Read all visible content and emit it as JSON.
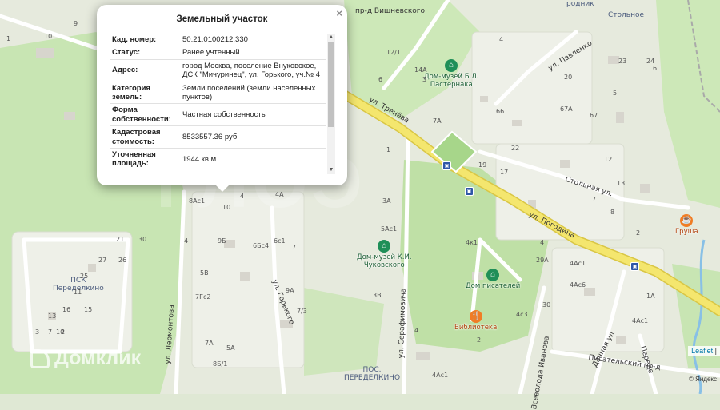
{
  "popup": {
    "title": "Земельный участок",
    "close_glyph": "×",
    "rows": [
      {
        "key": "Кад. номер:",
        "value": "50:21:0100212:330"
      },
      {
        "key": "Статус:",
        "value": "Ранее учтенный"
      },
      {
        "key": "Адрес:",
        "value": "город Москва, поселение Внуковское, ДСК \"Мичуринец\", ул. Горького, уч.№ 4"
      },
      {
        "key": "Категория земель:",
        "value": "Земли поселений (земли населенных пунктов)"
      },
      {
        "key": "Форма собственности:",
        "value": "Частная собственность"
      },
      {
        "key": "Кадастровая стоимость:",
        "value": "8533557.36 руб"
      },
      {
        "key": "Уточненная площадь:",
        "value": "1944 кв.м"
      }
    ]
  },
  "map": {
    "streets": {
      "vishnevsky": "пр-д Вишневского",
      "pavlenko": "ул. Павленко",
      "treneva": "ул. Тренёва",
      "pogodina": "ул. Погодина",
      "stolnaya": "Стольная ул.",
      "lermontova": "ул. Лермонтова",
      "gorkogo": "ул. Горького",
      "serafimovicha": "ул. Серафимовича",
      "dachnaya": "Дачная ул.",
      "pisatelsky": "Писательский пр-д",
      "vsevolod": "Всеволода Иванова",
      "peresv": "Переде"
    },
    "places": {
      "psk": "ПСК\nПеределкино",
      "pos": "ПОС.\nПЕРЕДЕЛКИНО",
      "stolnoe": "Стольное",
      "rodnik": "родник"
    },
    "pois": {
      "pasternak": "Дом-музей Б.Л.\nПастернака",
      "chukovsky": "Дом-музей К.И.\nЧуковского",
      "writers": "Дом писателей",
      "library": "Библиотека",
      "grusha": "Груша"
    },
    "house_numbers": [
      "10",
      "9",
      "1",
      "4",
      "12/1",
      "14А",
      "6",
      "23",
      "24",
      "20",
      "5",
      "67А",
      "67",
      "66",
      "22",
      "19",
      "17",
      "12",
      "13",
      "7",
      "8",
      "4",
      "2",
      "1",
      "3А",
      "5Ас1",
      "4к1",
      "29А",
      "4Ас1",
      "4Ас6",
      "30",
      "4с3",
      "1А",
      "4Ас1",
      "21",
      "30",
      "26",
      "27",
      "25",
      "16",
      "11",
      "13",
      "7",
      "15",
      "2",
      "10",
      "3",
      "4",
      "9Б",
      "6Бс4",
      "6с1",
      "7",
      "5В",
      "9А",
      "7/3",
      "7Гс2",
      "7А",
      "5А",
      "8Б/1",
      "4Ас1",
      "8Ас1",
      "10",
      "4",
      "4А",
      "3В",
      "7А",
      "2",
      "3",
      "4",
      "6",
      "8"
    ],
    "colors": {
      "road_major": "#f4e66e",
      "road_edge": "#d9c645",
      "forest": "#c4e3b0",
      "park": "#b7dd9d",
      "area": "#e8ebe2",
      "river": "#88c0e6"
    }
  },
  "branding": {
    "watermark": "Домклик"
  },
  "attribution": {
    "leaflet": "Leaflet",
    "sep": "|",
    "yandex": "© Яндекс"
  }
}
